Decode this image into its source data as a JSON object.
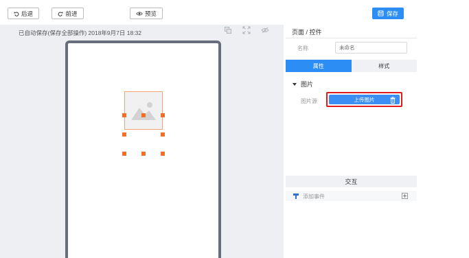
{
  "toolbar": {
    "undo_label": "后退",
    "redo_label": "前进",
    "preview_label": "预览",
    "save_label": "保存"
  },
  "canvas": {
    "autosave_text": "已自动保存(保存全部操作) 2018年9月7日 18:32",
    "tools": [
      "copy-icon",
      "fullscreen-icon",
      "hide-icon"
    ],
    "selected_element": "image-placeholder"
  },
  "panel": {
    "title": "页面 / 控件",
    "name_label": "名称",
    "name_value": "未命名",
    "tabs": [
      {
        "label": "属性",
        "active": true
      },
      {
        "label": "样式",
        "active": false
      }
    ],
    "section_title": "图片",
    "image_source_label": "图片源",
    "upload_label": "上传图片",
    "interaction_title": "交互",
    "add_event_label": "添加事件"
  },
  "colors": {
    "accent": "#2c8df4",
    "handle": "#f0702a",
    "highlight": "#e01b1b",
    "canvas_bg": "#eeeff3",
    "phone_frame": "#676d7b"
  }
}
